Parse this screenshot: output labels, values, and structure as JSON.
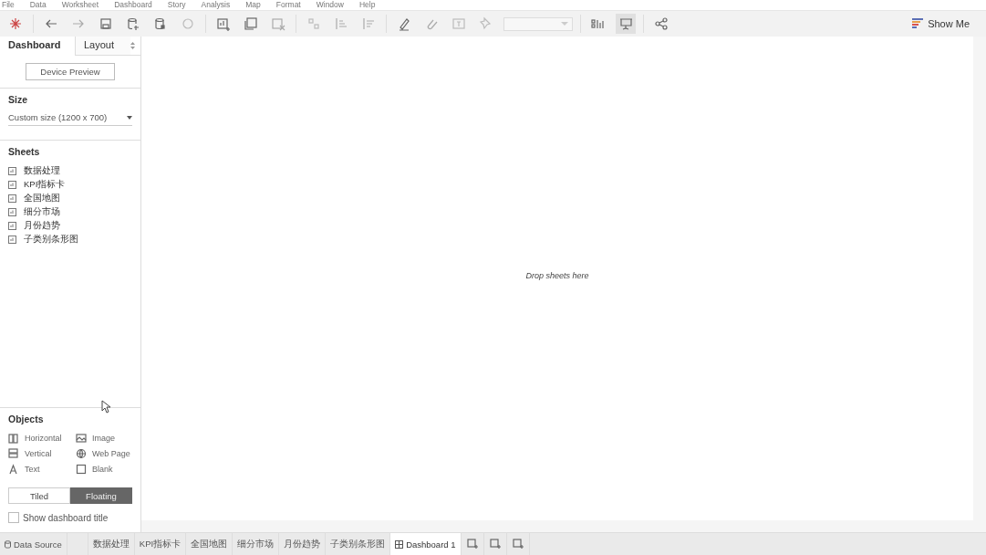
{
  "menu": [
    "File",
    "Data",
    "Worksheet",
    "Dashboard",
    "Story",
    "Analysis",
    "Map",
    "Format",
    "Window",
    "Help"
  ],
  "toolbar": {
    "show_me": "Show Me"
  },
  "side_panel": {
    "tabs": [
      {
        "label": "Dashboard",
        "selected": true
      },
      {
        "label": "Layout",
        "selected": false
      }
    ],
    "device_preview": "Device Preview",
    "size": {
      "heading": "Size",
      "value": "Custom size (1200 x 700)"
    },
    "sheets": {
      "heading": "Sheets",
      "items": [
        "数据处理",
        "KPI指标卡",
        "全国地图",
        "细分市场",
        "月份趋势",
        "子类别条形图"
      ]
    },
    "objects": {
      "heading": "Objects",
      "items": [
        {
          "label": "Horizontal",
          "kind": "horizontal"
        },
        {
          "label": "Image",
          "kind": "image"
        },
        {
          "label": "Vertical",
          "kind": "vertical"
        },
        {
          "label": "Web Page",
          "kind": "webpage"
        },
        {
          "label": "Text",
          "kind": "text"
        },
        {
          "label": "Blank",
          "kind": "blank"
        }
      ]
    },
    "mode": [
      {
        "label": "Tiled",
        "selected": false
      },
      {
        "label": "Floating",
        "selected": true
      }
    ],
    "show_title": {
      "label": "Show dashboard title",
      "checked": false
    }
  },
  "canvas": {
    "hint": "Drop sheets here"
  },
  "sheet_tabs": {
    "data_source": "Data Source",
    "tabs": [
      {
        "label": "数据处理",
        "kind": "sheet",
        "selected": false
      },
      {
        "label": "KPI指标卡",
        "kind": "sheet",
        "selected": false
      },
      {
        "label": "全国地图",
        "kind": "sheet",
        "selected": false
      },
      {
        "label": "细分市场",
        "kind": "sheet",
        "selected": false
      },
      {
        "label": "月份趋势",
        "kind": "sheet",
        "selected": false
      },
      {
        "label": "子类别条形图",
        "kind": "sheet",
        "selected": false
      },
      {
        "label": "Dashboard 1",
        "kind": "dashboard",
        "selected": true
      }
    ]
  }
}
